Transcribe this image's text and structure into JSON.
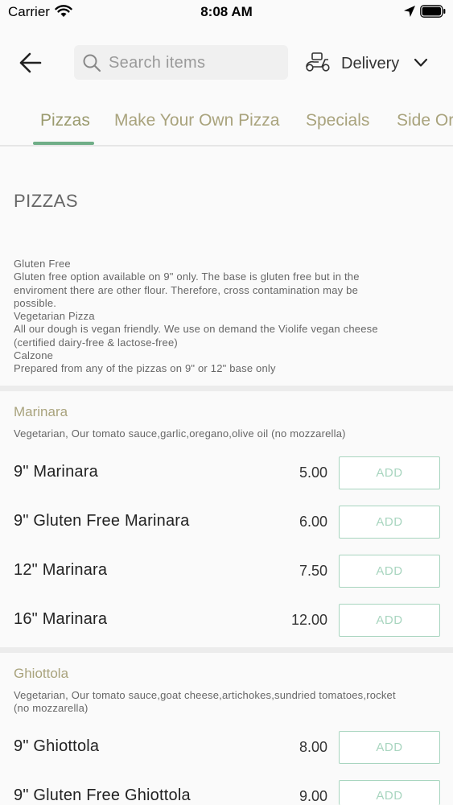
{
  "status": {
    "carrier": "Carrier",
    "time": "8:08 AM"
  },
  "header": {
    "search_placeholder": "Search items",
    "delivery_label": "Delivery"
  },
  "tabs": [
    "Pizzas",
    "Make Your Own Pizza",
    "Specials",
    "Side Orders"
  ],
  "section": {
    "title": "PIZZAS",
    "description_lines": [
      "Gluten Free",
      "Gluten free option available on 9\" only. The base is gluten free but in the",
      "enviroment there are other flour. Therefore, cross contamination may be",
      "possible.",
      "Vegetarian Pizza",
      "All our dough is vegan friendly. We use on demand the Violife vegan cheese",
      "(certified dairy-free & lactose-free)",
      "Calzone",
      "Prepared from any of the pizzas on 9\" or 12\" base only"
    ]
  },
  "groups": [
    {
      "name": "Marinara",
      "description_lines": [
        "Vegetarian, Our tomato sauce,garlic,oregano,olive oil (no mozzarella)"
      ],
      "items": [
        {
          "name": "9\" Marinara",
          "price": "5.00",
          "add_label": "ADD"
        },
        {
          "name": "9\" Gluten Free Marinara",
          "price": "6.00",
          "add_label": "ADD"
        },
        {
          "name": "12\" Marinara",
          "price": "7.50",
          "add_label": "ADD"
        },
        {
          "name": "16\" Marinara",
          "price": "12.00",
          "add_label": "ADD"
        }
      ]
    },
    {
      "name": "Ghiottola",
      "description_lines": [
        "Vegetarian, Our tomato sauce,goat cheese,artichokes,sundried tomatoes,rocket",
        "(no mozzarella)"
      ],
      "items": [
        {
          "name": "9\" Ghiottola",
          "price": "8.00",
          "add_label": "ADD"
        },
        {
          "name": "9\" Gluten Free Ghiottola",
          "price": "9.00",
          "add_label": "ADD"
        }
      ]
    }
  ]
}
